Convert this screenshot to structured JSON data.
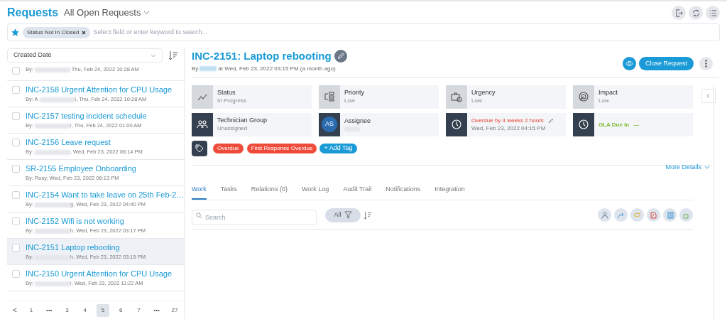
{
  "header": {
    "title": "Requests",
    "view": "All Open Requests"
  },
  "filter_bar": {
    "chips": [
      {
        "label": "Status Not In Closed"
      }
    ],
    "placeholder": "Select field or enter keyword to search..."
  },
  "sort": {
    "field": "Created Date"
  },
  "requests": [
    {
      "by": "By:",
      "redacted": true,
      "meta": " Thu, Feb 24, 2022 10:28 AM",
      "selected": false
    },
    {
      "title": "INC-2158 Urgent Attention for CPU Usage",
      "by": "By: A",
      "redacted": true,
      "meta": "i, Thu, Feb 24, 2022 10:28 AM",
      "selected": false
    },
    {
      "title": "INC-2157 testing incident schedule",
      "by": "By:",
      "redacted": true,
      "meta": "i, Thu, Feb 24, 2022 01:00 AM",
      "selected": false
    },
    {
      "title": "INC-2156 Leave request",
      "by": "By:",
      "redacted": true,
      "meta": ", Wed, Feb 23, 2022 06:14 PM",
      "selected": false
    },
    {
      "title": "SR-2155 Employee Onboarding",
      "by": "By: Rosy, Wed, Feb 23, 2022 06:13 PM",
      "redacted": false,
      "selected": false
    },
    {
      "title": "INC-2154 Want to take leave on 25th Feb-2…",
      "by": "By:",
      "redacted": true,
      "meta": "g, Wed, Feb 23, 2022 04:40 PM",
      "selected": false
    },
    {
      "title": "INC-2152 Wifi is not working",
      "by": "By:",
      "redacted": true,
      "meta": "h, Wed, Feb 23, 2022 03:17 PM",
      "selected": false
    },
    {
      "title": "INC-2151 Laptop rebooting",
      "by": "By:",
      "redacted": true,
      "meta": "h, Wed, Feb 23, 2022 03:15 PM",
      "selected": true
    },
    {
      "title": "INC-2150 Urgent Attention for CPU Usage",
      "by": "By:",
      "redacted": true,
      "meta": "i, Wed, Feb 23, 2022 11:22 AM",
      "selected": false
    }
  ],
  "pagination": {
    "prev": "<",
    "pages": [
      {
        "label": "1",
        "selected": false
      },
      {
        "label": "•••",
        "selected": false
      },
      {
        "label": "3",
        "selected": false
      },
      {
        "label": "4",
        "selected": false
      },
      {
        "label": "5",
        "selected": true
      },
      {
        "label": "6",
        "selected": false
      },
      {
        "label": "7",
        "selected": false
      },
      {
        "label": "•••",
        "selected": false
      },
      {
        "label": "27",
        "selected": false
      }
    ]
  },
  "detail": {
    "title": "INC-2151: Laptop rebooting",
    "by": "By",
    "by_suffix": "at Wed, Feb 23, 2022 03:15 PM (a month ago)",
    "close_button": "Close Request",
    "fields": [
      {
        "kind": "light",
        "label": "Status",
        "value": "In Progress"
      },
      {
        "kind": "light",
        "label": "Priority",
        "value": "Low"
      },
      {
        "kind": "light",
        "label": "Urgency",
        "value": "Low"
      },
      {
        "kind": "light",
        "label": "Impact",
        "value": "Low"
      },
      {
        "kind": "dark",
        "label": "Technician Group",
        "value": "Unassigned"
      },
      {
        "kind": "avatar",
        "label": "Assignee",
        "avatar": "AS"
      },
      {
        "kind": "due",
        "label": "Overdue by 4 weeks 2 hours",
        "value": "Wed, Feb 23, 2022 04:15 PM"
      },
      {
        "kind": "ola",
        "label": "OLA Due In",
        "value": "---"
      }
    ],
    "tags": [
      {
        "label": "Overdue",
        "color": "#ee4b3b"
      },
      {
        "label": "First Response Overdue",
        "color": "#ee4b3b"
      }
    ],
    "add_tag": "+ Add Tag",
    "more_details": "More Details",
    "tabs": [
      {
        "label": "Work",
        "selected": true
      },
      {
        "label": "Tasks",
        "selected": false
      },
      {
        "label": "Relations (0)",
        "selected": false
      },
      {
        "label": "Work Log",
        "selected": false
      },
      {
        "label": "Audit Trail",
        "selected": false
      },
      {
        "label": "Notifications",
        "selected": false
      },
      {
        "label": "Integration",
        "selected": false
      }
    ],
    "work": {
      "search_placeholder": "Search",
      "filter": "All"
    }
  }
}
